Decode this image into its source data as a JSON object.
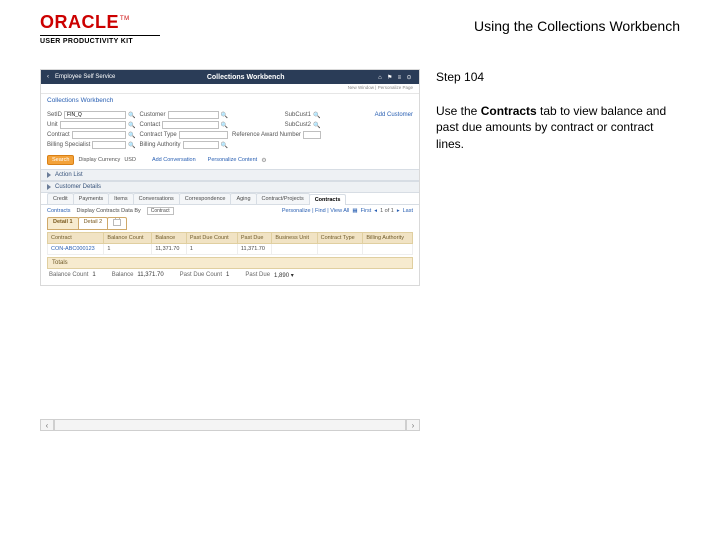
{
  "brand": {
    "logo": "ORACLE",
    "tm": "TM",
    "product": "USER PRODUCTIVITY KIT"
  },
  "title": "Using the Collections Workbench",
  "step": "Step 104",
  "instruction_pre": "Use the ",
  "instruction_bold": "Contracts",
  "instruction_post": " tab to view balance and past due amounts by contract or contract lines.",
  "app": {
    "nav_back": "‹",
    "nav_left": "Employee Self Service",
    "nav_title": "Collections Workbench",
    "nav_icons": [
      "⌂",
      "⚑",
      "≡",
      "⊙"
    ],
    "subbar": "New Window | Personalize Page",
    "crumb": "Collections Workbench",
    "filters": {
      "setid_l": "SetID",
      "setid_v": "FIN_Q",
      "unit_l": "Unit",
      "unit_v": "",
      "cust_l": "Customer",
      "cust_v": "",
      "subcust1_l": "SubCust1",
      "contract_l": "Contract",
      "contract_v": "",
      "contact_l": "Contact",
      "contact_v": "",
      "contract_type_l": "Contract Type",
      "contract_type_v": "",
      "subcust2_l": "SubCust2",
      "billspec_l": "Billing Specialist",
      "billspec_v": "",
      "billauth_l": "Billing Authority",
      "billauth_v": "",
      "refaward_l": "Reference Award Number",
      "refaward_v": ""
    },
    "btn_search": "Search",
    "display_currency_l": "Display Currency",
    "display_currency_v": "USD",
    "add_conv": "Add Conversation",
    "personalize": "Personalize Content",
    "action_list": "Action List",
    "cust_details": "Customer Details",
    "tabs": [
      "Credit",
      "Payments",
      "Items",
      "Conversations",
      "Correspondence",
      "Aging",
      "Contract/Projects",
      "Contracts"
    ],
    "active_tab": 7,
    "grid_title": "Contracts",
    "grid_level_l": "Display Contracts Data By",
    "grid_level_v": "Contract",
    "grid_actions": "Personalize | Find | View All",
    "grid_first": "First",
    "grid_range": "1 of 1",
    "grid_last": "Last",
    "subtabs": [
      "Detail 1",
      "Detail 2"
    ],
    "active_subtab": 0,
    "cols": [
      "Contract",
      "Balance Count",
      "Balance",
      "Past Due Count",
      "Past Due",
      "Business Unit",
      "Contract Type",
      "Billing Authority"
    ],
    "row": [
      "CON-ABC000123",
      "1",
      "11,371.70",
      "1",
      "11,371.70",
      "",
      "",
      ""
    ],
    "totals_label": "Totals",
    "totals": {
      "balcnt_l": "Balance Count",
      "balcnt_v": "1",
      "bal_l": "Balance",
      "bal_v": "11,371.70",
      "pdc_l": "Past Due Count",
      "pdc_v": "1",
      "pd_l": "Past Due",
      "pd_v": "1,890 ▾"
    }
  }
}
